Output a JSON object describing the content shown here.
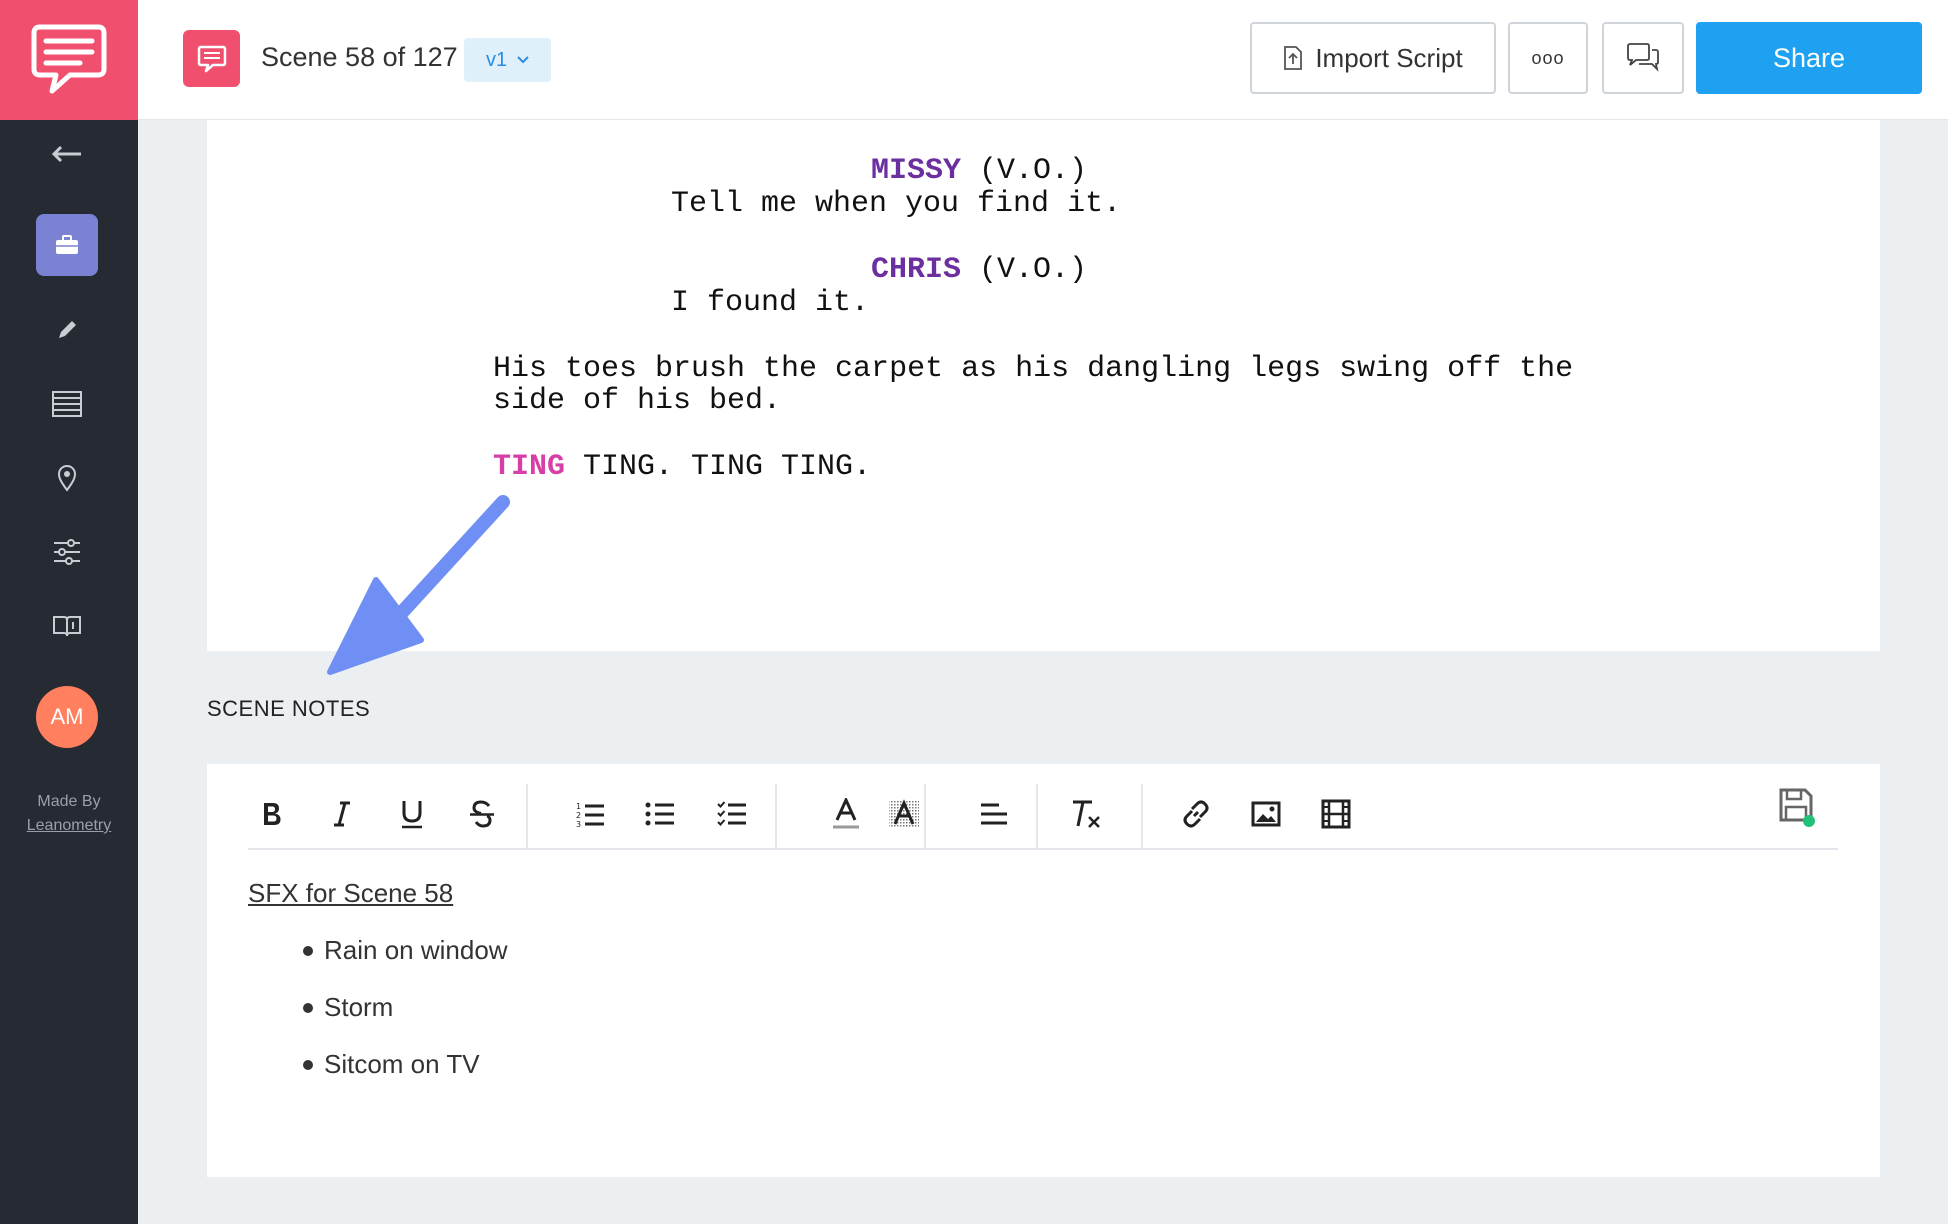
{
  "header": {
    "scene_title": "Scene 58 of 127",
    "version": "v1",
    "import_label": "Import Script",
    "more_label": "ooo",
    "share_label": "Share"
  },
  "sidebar": {
    "avatar_initials": "AM",
    "made_by": "Made By",
    "made_by_link": "Leanometry",
    "items": [
      {
        "icon": "back-arrow-icon"
      },
      {
        "icon": "briefcase-icon",
        "active": true
      },
      {
        "icon": "pencil-icon"
      },
      {
        "icon": "table-icon"
      },
      {
        "icon": "location-pin-icon"
      },
      {
        "icon": "sliders-icon"
      },
      {
        "icon": "book-icon"
      }
    ]
  },
  "script": {
    "char1": "MISSY",
    "ext1": " (V.O.)",
    "line1": "Tell me when you find it.",
    "char2": "CHRIS",
    "ext2": " (V.O.)",
    "line2": "I found it.",
    "action1": "His toes brush the carpet as his dangling legs swing off the",
    "action2": "side of his bed.",
    "sfx": "TING",
    "sfx_rest": " TING. TING TING."
  },
  "notes": {
    "label": "SCENE NOTES",
    "heading": "SFX for Scene 58",
    "items": [
      "Rain on window",
      "Storm",
      "Sitcom on TV"
    ]
  },
  "colors": {
    "brand_pink": "#f0506e",
    "share_blue": "#1ea1f1",
    "character_purple": "#6b2fa0",
    "sfx_magenta": "#d73ea6",
    "arrow_blue": "#6f8ff5",
    "sidebar_bg": "#252a33"
  }
}
